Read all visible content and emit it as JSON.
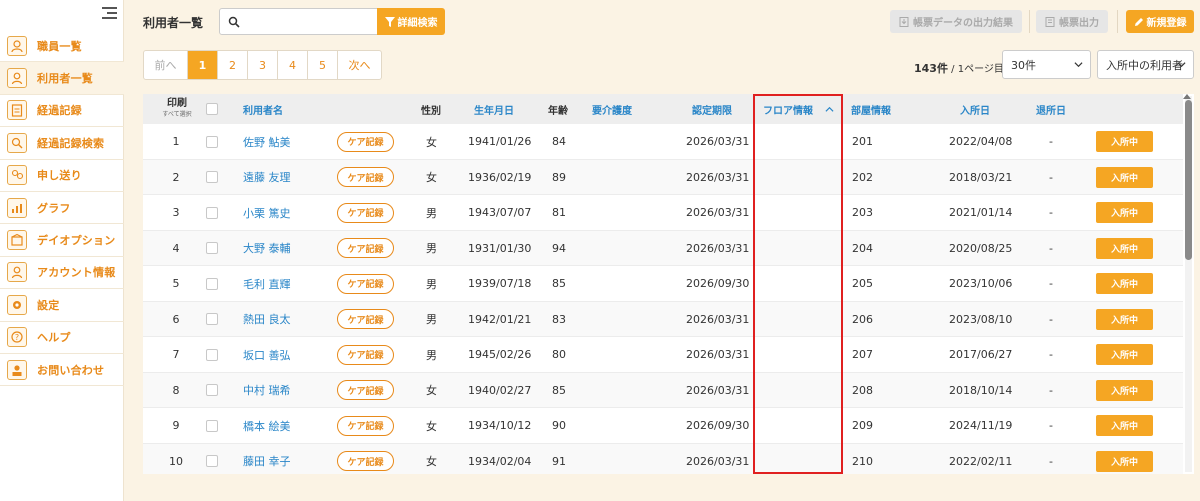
{
  "sidebar": {
    "items": [
      {
        "label": "職員一覧",
        "icon": "staff-icon"
      },
      {
        "label": "利用者一覧",
        "icon": "users-icon"
      },
      {
        "label": "経過記録",
        "icon": "clipboard-icon"
      },
      {
        "label": "経過記録検索",
        "icon": "record-search-icon"
      },
      {
        "label": "申し送り",
        "icon": "handover-icon"
      },
      {
        "label": "グラフ",
        "icon": "chart-icon"
      },
      {
        "label": "デイオプション",
        "icon": "day-option-icon"
      },
      {
        "label": "アカウント情報",
        "icon": "account-icon"
      },
      {
        "label": "設定",
        "icon": "gear-icon"
      },
      {
        "label": "ヘルプ",
        "icon": "help-icon"
      },
      {
        "label": "お問い合わせ",
        "icon": "contact-icon"
      }
    ]
  },
  "header": {
    "title": "利用者一覧",
    "search_placeholder": "",
    "detail_search_label": "詳細検索",
    "export_result_label": "帳票データの出力結果",
    "export_label": "帳票出力",
    "new_label": "新規登録"
  },
  "pagination": {
    "prev": "前へ",
    "pages": [
      "1",
      "2",
      "3",
      "4",
      "5"
    ],
    "current": "1",
    "next": "次へ"
  },
  "count": {
    "total": "143件",
    "page": "/ 1ページ目"
  },
  "selects": {
    "per_page": "30件",
    "status": "入所中の利用者"
  },
  "table": {
    "headers": {
      "print": "印刷",
      "select_all": "すべて選択",
      "name": "利用者名",
      "gender": "性別",
      "birthdate": "生年月日",
      "age": "年齢",
      "care_level": "要介護度",
      "cert_period": "認定期限",
      "floor": "フロア情報",
      "room": "部屋情報",
      "admission": "入所日",
      "discharge": "退所日"
    },
    "care_label": "ケア記録",
    "status_label": "入所中",
    "rows": [
      {
        "no": "1",
        "name": "佐野 鮎美",
        "gender": "女",
        "birth": "1941/01/26",
        "age": "84",
        "cert": "2026/03/31",
        "room": "201",
        "admit": "2022/04/08",
        "discharge": "-"
      },
      {
        "no": "2",
        "name": "遠藤 友理",
        "gender": "女",
        "birth": "1936/02/19",
        "age": "89",
        "cert": "2026/03/31",
        "room": "202",
        "admit": "2018/03/21",
        "discharge": "-"
      },
      {
        "no": "3",
        "name": "小栗 篤史",
        "gender": "男",
        "birth": "1943/07/07",
        "age": "81",
        "cert": "2026/03/31",
        "room": "203",
        "admit": "2021/01/14",
        "discharge": "-"
      },
      {
        "no": "4",
        "name": "大野 泰輔",
        "gender": "男",
        "birth": "1931/01/30",
        "age": "94",
        "cert": "2026/03/31",
        "room": "204",
        "admit": "2020/08/25",
        "discharge": "-"
      },
      {
        "no": "5",
        "name": "毛利 直輝",
        "gender": "男",
        "birth": "1939/07/18",
        "age": "85",
        "cert": "2026/09/30",
        "room": "205",
        "admit": "2023/10/06",
        "discharge": "-"
      },
      {
        "no": "6",
        "name": "熱田 良太",
        "gender": "男",
        "birth": "1942/01/21",
        "age": "83",
        "cert": "2026/03/31",
        "room": "206",
        "admit": "2023/08/10",
        "discharge": "-"
      },
      {
        "no": "7",
        "name": "坂口 善弘",
        "gender": "男",
        "birth": "1945/02/26",
        "age": "80",
        "cert": "2026/03/31",
        "room": "207",
        "admit": "2017/06/27",
        "discharge": "-"
      },
      {
        "no": "8",
        "name": "中村 瑞希",
        "gender": "女",
        "birth": "1940/02/27",
        "age": "85",
        "cert": "2026/03/31",
        "room": "208",
        "admit": "2018/10/14",
        "discharge": "-"
      },
      {
        "no": "9",
        "name": "橋本 絵美",
        "gender": "女",
        "birth": "1934/10/12",
        "age": "90",
        "cert": "2026/09/30",
        "room": "209",
        "admit": "2024/11/19",
        "discharge": "-"
      },
      {
        "no": "10",
        "name": "藤田 幸子",
        "gender": "女",
        "birth": "1934/02/04",
        "age": "91",
        "cert": "2026/03/31",
        "room": "210",
        "admit": "2022/02/11",
        "discharge": "-"
      }
    ]
  },
  "colors": {
    "accent": "#f5a623",
    "link": "#2a86c8",
    "highlight": "#e02020"
  }
}
